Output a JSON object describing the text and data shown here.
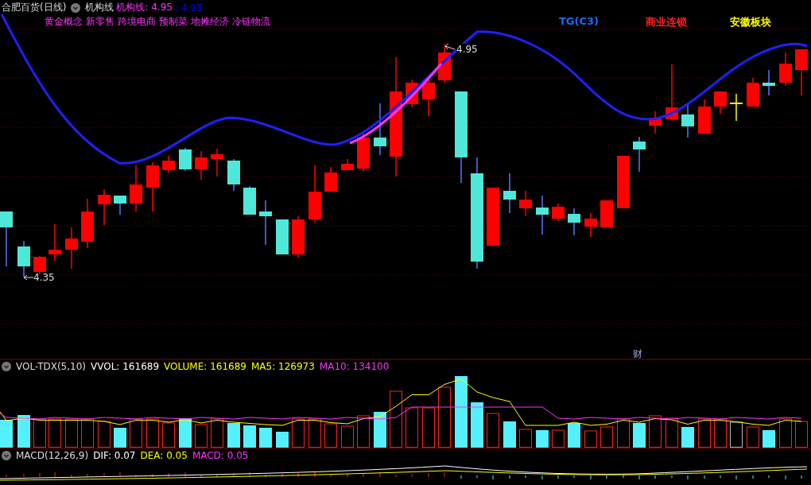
{
  "header": {
    "stock_name": "合肥百货(日线)",
    "indicator_name": "机构线",
    "values": [
      {
        "text": "机构线: 4.95",
        "color": "#ff33ff"
      },
      {
        "text": ": 4.95",
        "color": "#0000ff"
      }
    ]
  },
  "concept_tags": [
    "黄金概念",
    "新零售",
    "跨境电商",
    "预制菜",
    "地摊经济",
    "冷链物流"
  ],
  "sector_labels": [
    {
      "text": "TG(C3)",
      "color": "#1a6cff"
    },
    {
      "text": "商业连锁",
      "color": "#ff2020"
    },
    {
      "text": "安徽板块",
      "color": "#ffff00"
    }
  ],
  "price_markers": {
    "high": "4.95",
    "low": "4.35"
  },
  "event_marker": "财",
  "volume_panel": {
    "name": "VOL-TDX(5,10)",
    "values": [
      {
        "text": "VVOL: 161689",
        "color": "#ffffff"
      },
      {
        "text": "VOLUME: 161689",
        "color": "#ffff00"
      },
      {
        "text": "MA5: 126973",
        "color": "#ffff00"
      },
      {
        "text": "MA10: 134100",
        "color": "#ff33ff"
      }
    ]
  },
  "macd_panel": {
    "name": "MACD(12,26,9)",
    "values": [
      {
        "text": "DIF: 0.07",
        "color": "#ffffff"
      },
      {
        "text": "DEA: 0.05",
        "color": "#ffff00"
      },
      {
        "text": "MACD: 0.05",
        "color": "#ff33ff"
      }
    ]
  }
}
